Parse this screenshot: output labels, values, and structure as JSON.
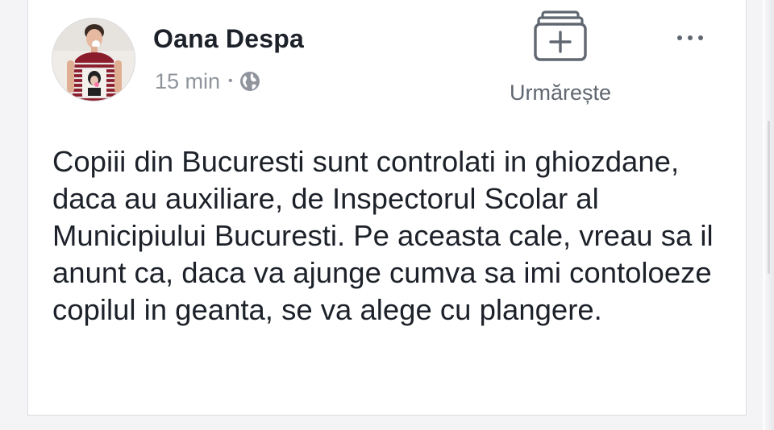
{
  "post": {
    "author_name": "Oana Despa",
    "time_ago": "15 min",
    "separator": "•",
    "privacy_icon": "globe-icon",
    "follow_label": "Urmărește",
    "follow_icon": "stacked-plus-icon",
    "more_icon": "more-options-icon",
    "text": "Copiii din Bucuresti sunt controlati in ghiozdane, daca au auxiliare, de Inspectorul Scolar al Municipiului Bucuresti. Pe aceasta cale, vreau sa il anunt ca, daca va ajunge cumva sa imi contoloeze copilul in geanta, se va alege cu plangere."
  },
  "colors": {
    "author": "#1d2129",
    "meta": "#90949c",
    "follow": "#606770",
    "body_text": "#1d2129"
  }
}
